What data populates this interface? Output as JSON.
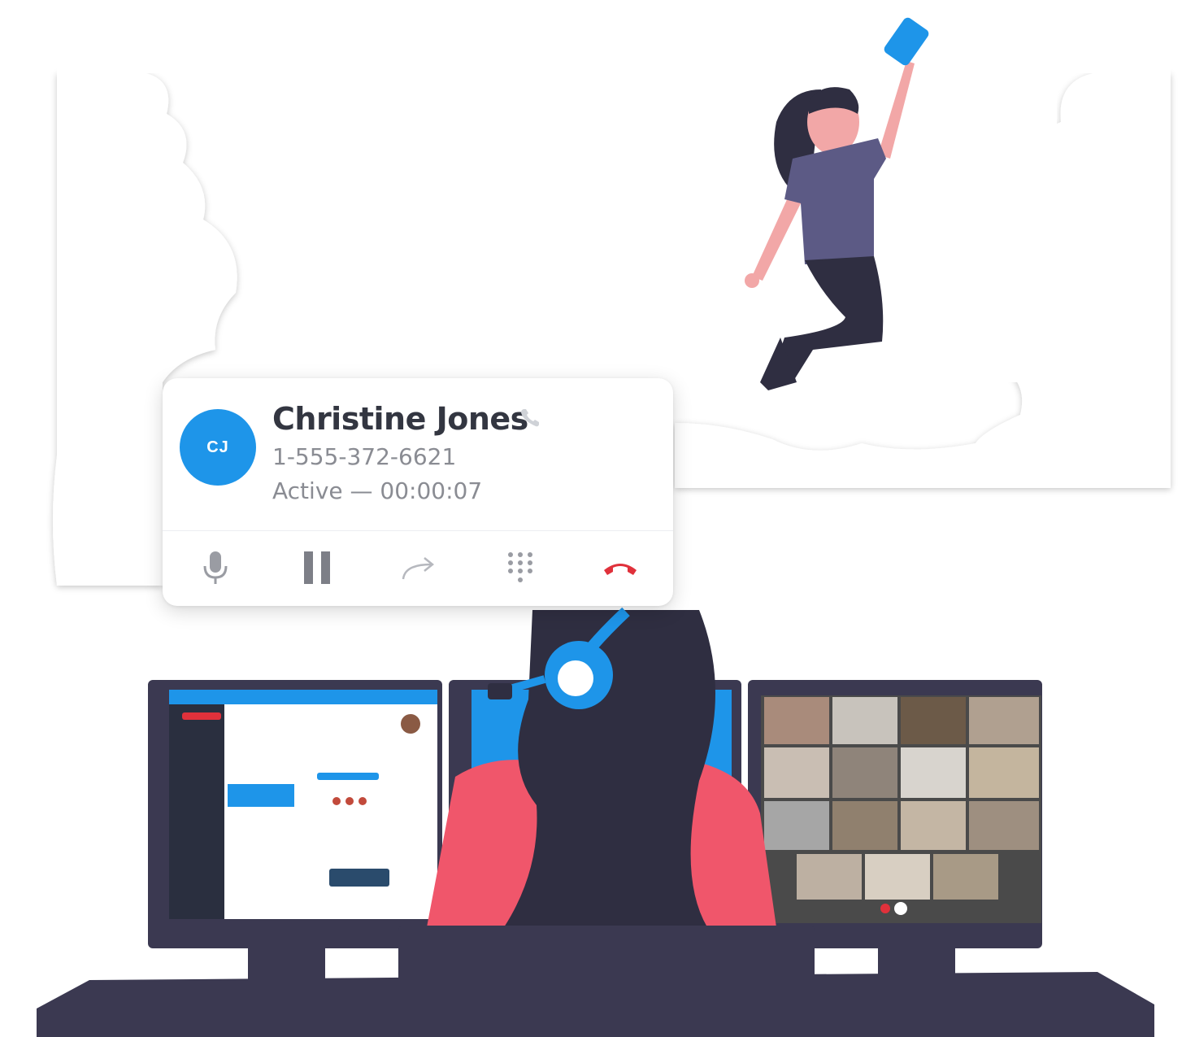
{
  "call": {
    "avatar_initials": "CJ",
    "caller_name": "Christine Jones",
    "phone_number": "1-555-372-6621",
    "status": "Active — 00:00:07",
    "call_type_icon": "phone-icon",
    "controls": [
      {
        "name": "mute",
        "icon": "microphone-icon"
      },
      {
        "name": "hold",
        "icon": "pause-icon"
      },
      {
        "name": "transfer",
        "icon": "forward-arrow-icon"
      },
      {
        "name": "keypad",
        "icon": "dialpad-icon"
      },
      {
        "name": "hang-up",
        "icon": "hang-up-icon"
      }
    ]
  },
  "colors": {
    "accent_blue": "#1e95e9",
    "hang_up_red": "#e0313b",
    "hair_dark": "#2f2e41",
    "shirt_purple": "#5c5a85",
    "skin_pink": "#f2a7a7",
    "sweater_pink": "#f0566b"
  }
}
